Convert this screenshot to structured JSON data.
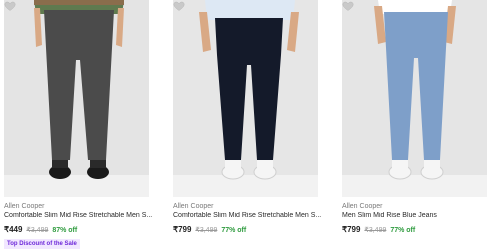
{
  "products": [
    {
      "brand": "Allen Cooper",
      "name": "Comfortable Slim Mid Rise Stretchable Men S...",
      "price": "₹449",
      "mrp": "₹3,499",
      "discount": "87% off",
      "jeans_color": "#4b4b4b",
      "tag": "Top Discount of the Sale"
    },
    {
      "brand": "Allen Cooper",
      "name": "Comfortable Slim Mid Rise Stretchable Men S...",
      "price": "₹799",
      "mrp": "₹3,499",
      "discount": "77% off",
      "jeans_color": "#141a2a"
    },
    {
      "brand": "Allen Cooper",
      "name": "Men Slim Mid Rise Blue Jeans",
      "price": "₹799",
      "mrp": "₹3,499",
      "discount": "77% off",
      "jeans_color": "#7e9fc9"
    }
  ],
  "icons": {
    "wishlist": "heart-outline-icon"
  }
}
